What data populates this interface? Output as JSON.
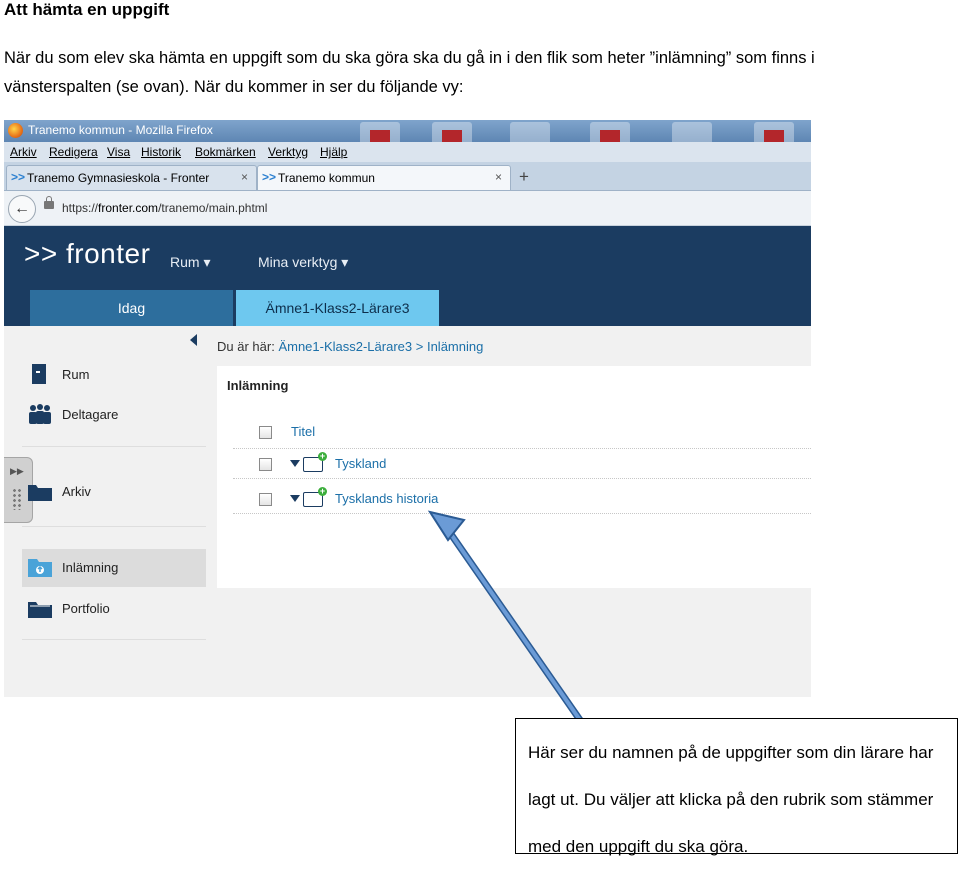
{
  "document": {
    "heading": "Att hämta en uppgift",
    "paragraph": "När du som elev ska hämta en uppgift som du ska göra ska du gå in i den flik som heter ”inlämning” som finns i vänsterspalten (se ovan). När du kommer in ser du följande vy:",
    "callout": "Här ser du namnen på de uppgifter som din lärare har lagt ut. Du väljer att klicka på den rubrik som stämmer med den uppgift du ska göra."
  },
  "browser": {
    "window_title": "Tranemo kommun - Mozilla Firefox",
    "menu": [
      "Arkiv",
      "Redigera",
      "Visa",
      "Historik",
      "Bokmärken",
      "Verktyg",
      "Hjälp"
    ],
    "tabs": [
      {
        "label": "Tranemo Gymnasieskola - Fronter",
        "close": "×"
      },
      {
        "label": "Tranemo kommun",
        "close": "×"
      }
    ],
    "new_tab": "+",
    "url_prefix": "https://",
    "url_domain": "fronter.com",
    "url_path": "/tranemo/main.phtml"
  },
  "fronter": {
    "logo": ">> fronter",
    "nav": [
      "Rum",
      "Mina verktyg"
    ],
    "tabs": [
      "Idag",
      "Ämne1-Klass2-Lärare3"
    ],
    "sidebar": [
      "Rum",
      "Deltagare",
      "Arkiv",
      "Inlämning",
      "Portfolio"
    ],
    "breadcrumb": {
      "prefix": "Du är här:",
      "room": "Ämne1-Klass2-Lärare3",
      "sep": ">",
      "current": "Inlämning"
    },
    "panel_title": "Inlämning",
    "column_header": "Titel",
    "items": [
      "Tyskland",
      "Tysklands historia"
    ]
  },
  "colors": {
    "header_bg": "#1b3c61",
    "active_tab": "#6ec8ef",
    "link": "#1b6fa8",
    "arrow": "#5b8bc7"
  }
}
